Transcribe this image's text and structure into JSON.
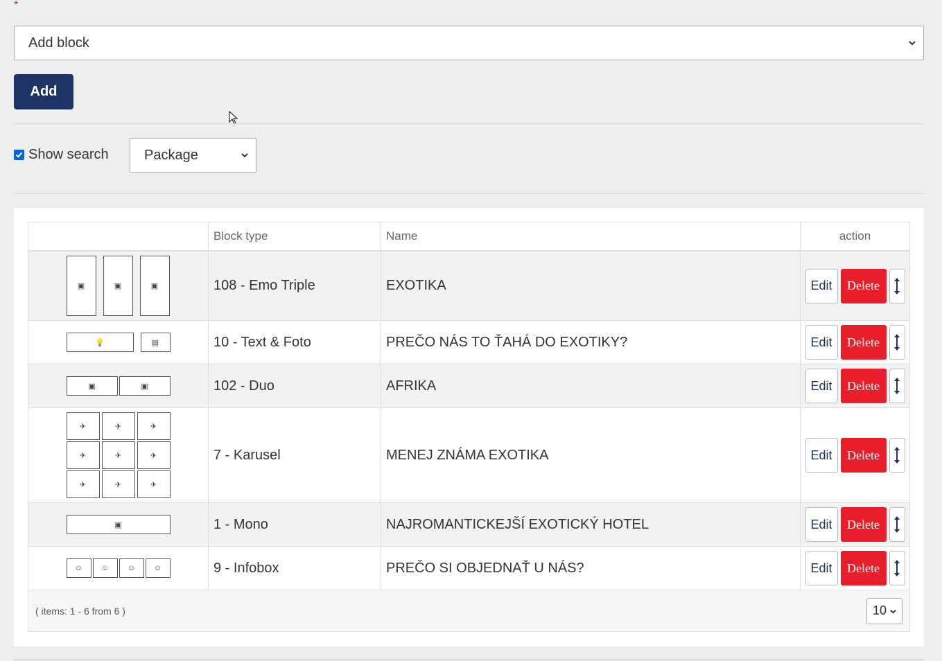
{
  "form": {
    "required_mark": "*",
    "block_select_value": "Add block",
    "add_label": "Add",
    "show_search_label": "Show search",
    "show_search_checked": true,
    "package_select_value": "Package"
  },
  "table": {
    "columns": [
      "",
      "Block type",
      "Name",
      "action"
    ],
    "rows": [
      {
        "preview": "emo-triple",
        "block_type": "108 - Emo Triple",
        "name": "EXOTIKA"
      },
      {
        "preview": "text-foto",
        "block_type": "10 - Text & Foto",
        "name": "PREČO NÁS TO ŤAHÁ DO EXOTIKY?"
      },
      {
        "preview": "duo",
        "block_type": "102 - Duo",
        "name": "AFRIKA"
      },
      {
        "preview": "karusel",
        "block_type": "7 - Karusel",
        "name": "MENEJ ZNÁMA EXOTIKA"
      },
      {
        "preview": "mono",
        "block_type": "1 - Mono",
        "name": "NAJROMANTICKEJŠÍ EXOTICKÝ HOTEL"
      },
      {
        "preview": "infobox",
        "block_type": "9 - Infobox",
        "name": "PREČO SI OBJEDNAŤ U NÁS?"
      }
    ],
    "edit_label": "Edit",
    "delete_label": "Delete",
    "items_info": "( items: 1 - 6 from 6 )",
    "per_page_value": "10"
  },
  "colors": {
    "primary": "#1c3466",
    "danger": "#e81e2a",
    "checkbox": "#0a63d6",
    "required": "#e0202a"
  },
  "icons": {
    "preview_image": "image-icon",
    "preview_lightbulb": "lightbulb-icon",
    "preview_document": "document-icon",
    "preview_plane": "plane-icon",
    "preview_smiley": "smiley-icon",
    "move": "vertical-arrows-icon",
    "select_arrow": "chevron-down-icon"
  }
}
